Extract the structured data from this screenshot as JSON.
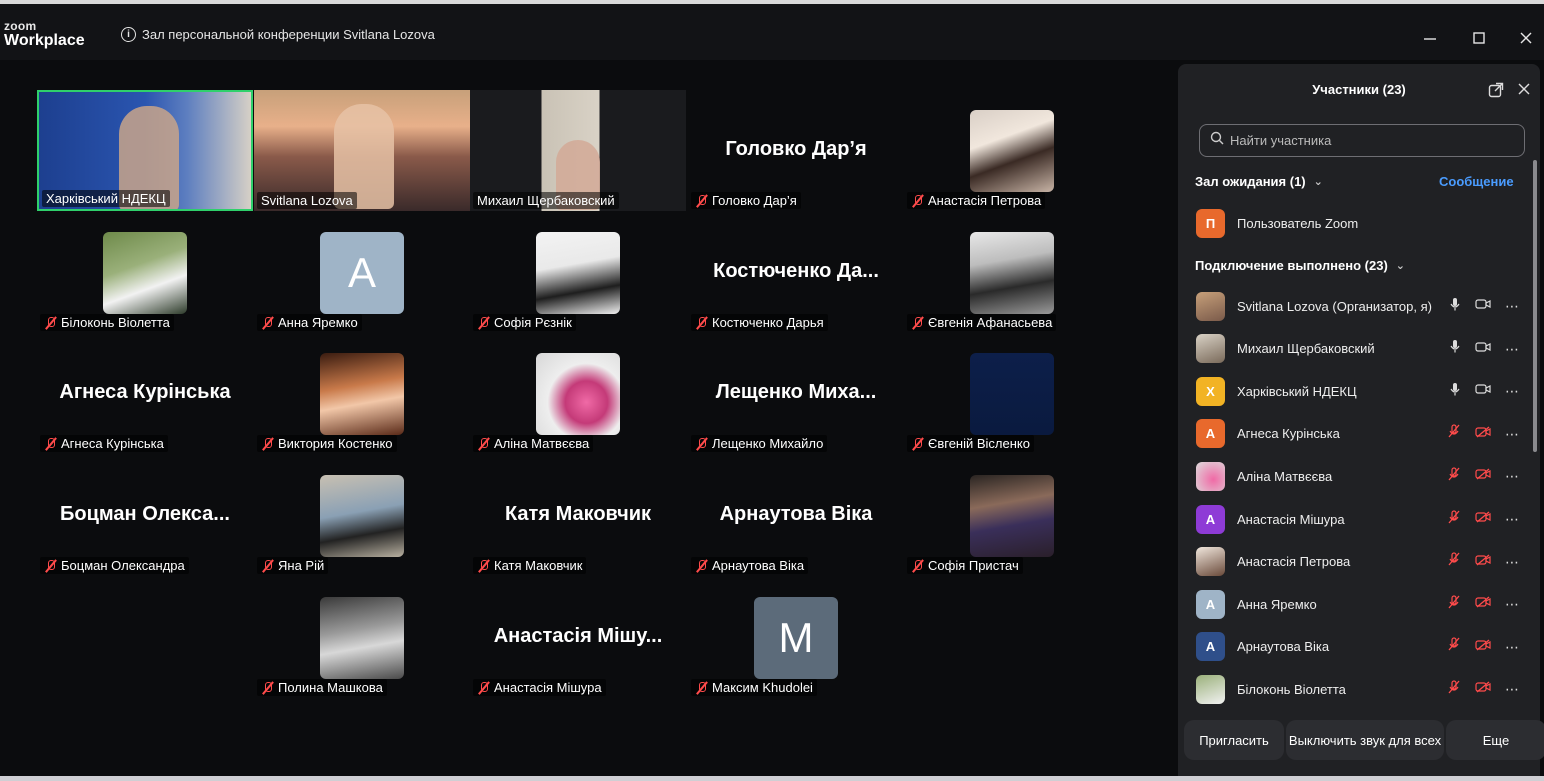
{
  "app": {
    "logo_top": "zoom",
    "logo_bottom": "Workplace"
  },
  "meeting": {
    "title": "Зал персональной конференции Svitlana Lozova"
  },
  "window_controls": [
    "minimize-icon",
    "maximize-icon",
    "close-icon"
  ],
  "gallery": {
    "tiles": [
      {
        "name": "Харківський НДЕКЦ",
        "kind": "video",
        "muted": false,
        "active": true
      },
      {
        "name": "Svitlana Lozova",
        "kind": "video",
        "muted": false
      },
      {
        "name": "Михаил Щербаковский",
        "kind": "video",
        "muted": false
      },
      {
        "name": "Головко Дар’я",
        "display": "Головко Дар’я",
        "kind": "name",
        "muted": true
      },
      {
        "name": "Анастасія Петрова",
        "kind": "photo",
        "muted": true
      },
      {
        "name": "Білоконь Віолетта",
        "kind": "photo",
        "muted": true
      },
      {
        "name": "Анна Яремко",
        "kind": "letter",
        "letter": "A",
        "muted": true
      },
      {
        "name": "Софія Рєзнік",
        "kind": "photo",
        "muted": true
      },
      {
        "name": "Костюченко Дарья",
        "display": "Костюченко Да...",
        "kind": "name",
        "muted": true
      },
      {
        "name": "Євгенія Афанасьева",
        "kind": "photo",
        "muted": true
      },
      {
        "name": "Агнеса Курінська",
        "display": "Агнеса Курінська",
        "kind": "name",
        "muted": true
      },
      {
        "name": "Виктория Костенко",
        "kind": "photo",
        "muted": true
      },
      {
        "name": "Аліна Матвєєва",
        "kind": "photo",
        "muted": true
      },
      {
        "name": "Лещенко Михайло",
        "display": "Лещенко Миха...",
        "kind": "name",
        "muted": true
      },
      {
        "name": "Євгеній Вісленко",
        "kind": "photo",
        "muted": true
      },
      {
        "name": "Боцман Олександра",
        "display": "Боцман Олекса...",
        "kind": "name",
        "muted": true
      },
      {
        "name": "Яна Рій",
        "kind": "photo",
        "muted": true
      },
      {
        "name": "Катя Маковчик",
        "display": "Катя Маковчик",
        "kind": "name",
        "muted": true
      },
      {
        "name": "Арнаутова Віка",
        "display": "Арнаутова Віка",
        "kind": "name",
        "muted": true
      },
      {
        "name": "Софія Пристач",
        "kind": "photo",
        "muted": true
      },
      {
        "name": "Полина Машкова",
        "kind": "photo",
        "muted": true
      },
      {
        "name": "Анастасія Мішура",
        "display": "Анастасія Мішу...",
        "kind": "name",
        "muted": true
      },
      {
        "name": "Максим Khudolei",
        "kind": "letter",
        "letter": "M",
        "muted": true
      }
    ]
  },
  "panel": {
    "title": "Участники (23)",
    "search_placeholder": "Найти участника",
    "waiting_section": "Зал ожидания (1)",
    "message_link": "Сообщение",
    "connected_section": "Подключение выполнено (23)",
    "waiting": [
      {
        "name": "Пользователь Zoom",
        "avatar_letter": "П",
        "avatar_color": "#e8692c"
      }
    ],
    "participants": [
      {
        "name": "Svitlana Lozova (Организатор, я)",
        "avatar_type": "photo",
        "mic": "on",
        "video": "on"
      },
      {
        "name": "Михаил Щербаковский",
        "avatar_type": "photo",
        "mic": "on",
        "video": "on"
      },
      {
        "name": "Харківський НДЕКЦ",
        "avatar_letter": "X",
        "avatar_color": "#f2b324",
        "mic": "on",
        "video": "on"
      },
      {
        "name": "Агнеса Курінська",
        "avatar_letter": "A",
        "avatar_color": "#e8692c",
        "mic": "muted",
        "video": "off"
      },
      {
        "name": "Аліна Матвєєва",
        "avatar_type": "photo",
        "mic": "muted",
        "video": "off"
      },
      {
        "name": "Анастасія Мішура",
        "avatar_letter": "A",
        "avatar_color": "#8e3bd6",
        "mic": "muted",
        "video": "off"
      },
      {
        "name": "Анастасія Петрова",
        "avatar_type": "photo",
        "mic": "muted",
        "video": "off"
      },
      {
        "name": "Анна Яремко",
        "avatar_letter": "A",
        "avatar_color": "#9fb4c7",
        "mic": "muted",
        "video": "off"
      },
      {
        "name": "Арнаутова Віка",
        "avatar_letter": "A",
        "avatar_color": "#2f4f8a",
        "mic": "muted",
        "video": "off"
      },
      {
        "name": "Білоконь Віолетта",
        "avatar_type": "photo",
        "mic": "muted",
        "video": "off"
      }
    ],
    "buttons": {
      "invite": "Пригласить",
      "mute_all": "Выключить звук для всех",
      "more": "Еще"
    }
  },
  "colors": {
    "active_speaker": "#2fd06b",
    "muted": "#ff4b4b",
    "link": "#4a9cff"
  }
}
